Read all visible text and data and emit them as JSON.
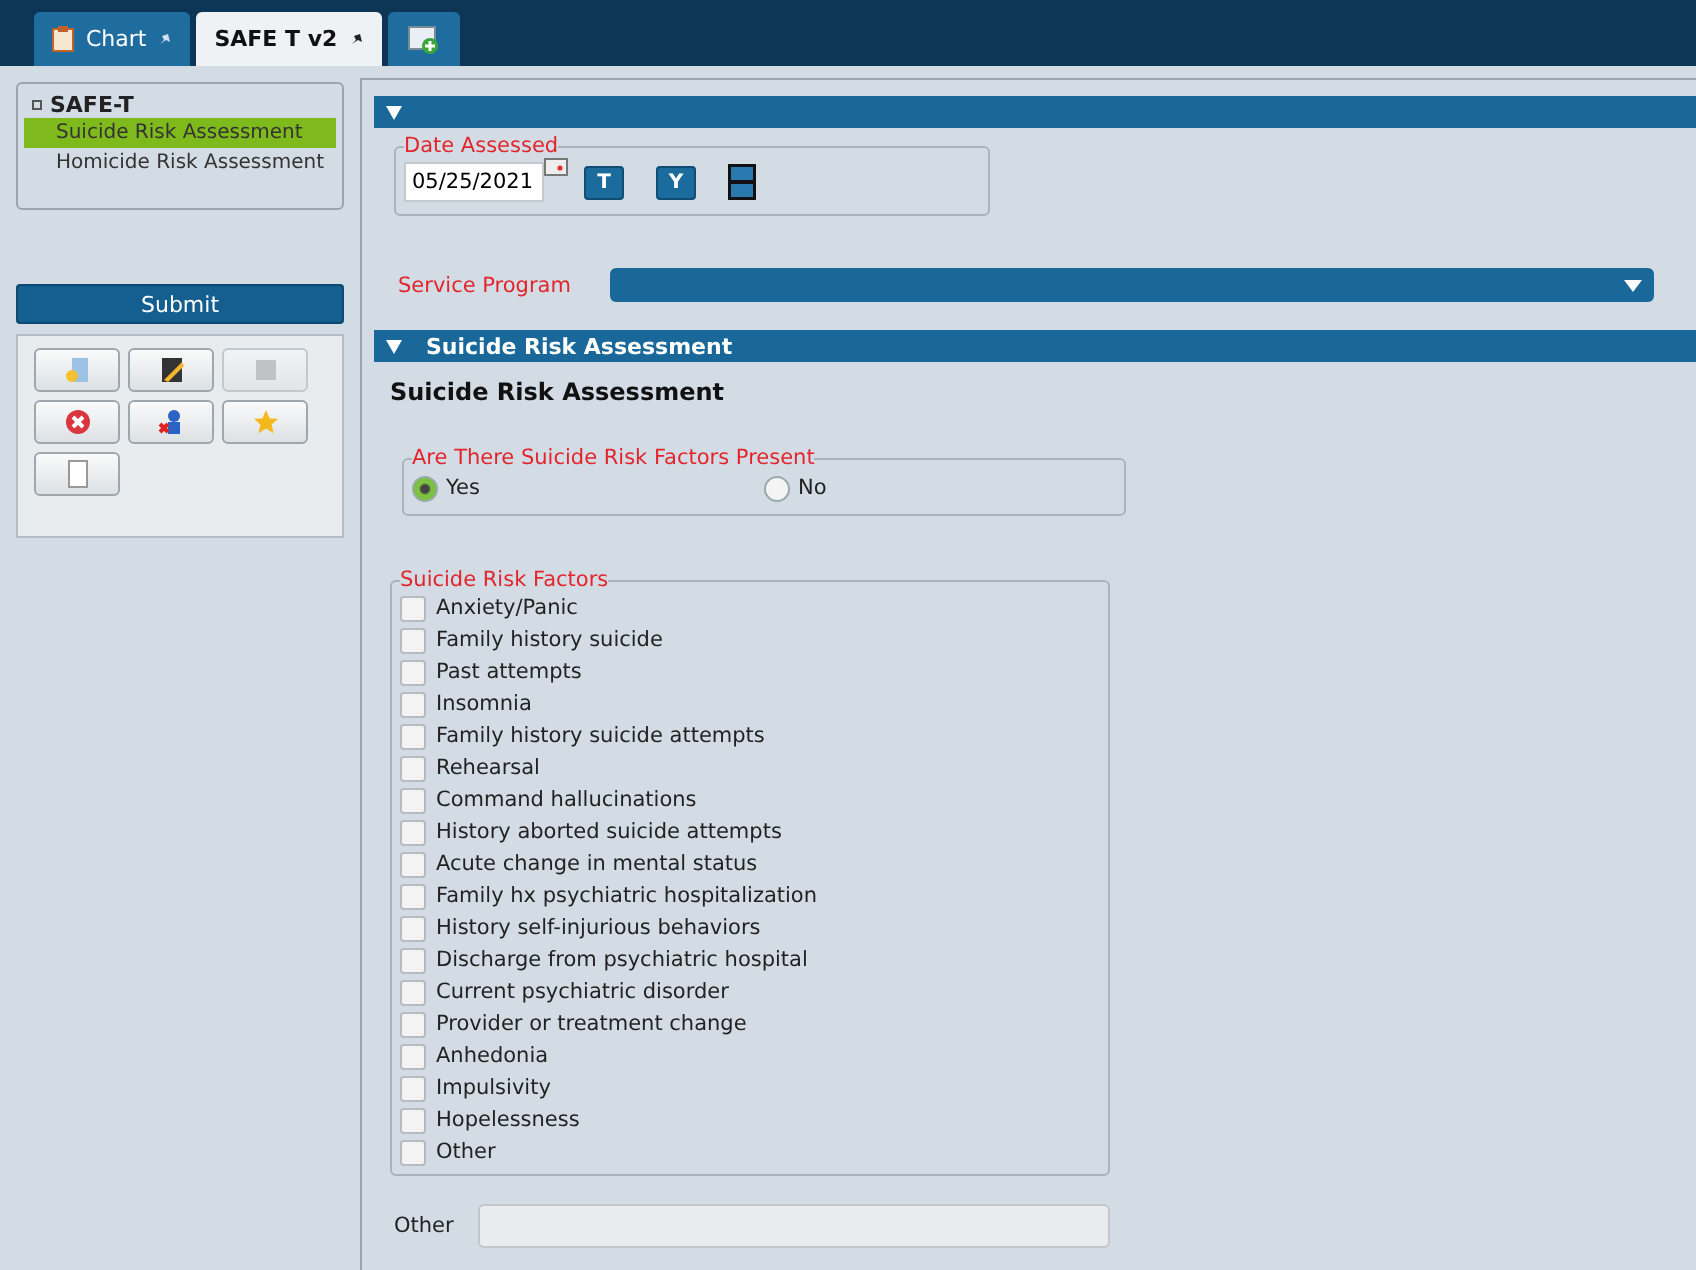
{
  "tabs": [
    {
      "label": "Chart",
      "selected": false
    },
    {
      "label": "SAFE T v2",
      "selected": true
    }
  ],
  "sidebar": {
    "group": "SAFE-T",
    "items": [
      {
        "label": "Suicide Risk Assessment",
        "selected": true
      },
      {
        "label": "Homicide Risk Assessment",
        "selected": false
      }
    ],
    "submit": "Submit",
    "toolbar": [
      {
        "disabled": false
      },
      {
        "disabled": false
      },
      {
        "disabled": true
      },
      {
        "disabled": false
      },
      {
        "disabled": false
      },
      {
        "disabled": false
      },
      {
        "disabled": false
      }
    ]
  },
  "form": {
    "date_assessed": {
      "label": "Date Assessed",
      "value": "05/25/2021",
      "today": "T",
      "yesterday": "Y"
    },
    "service_program": {
      "label": "Service Program"
    },
    "section": {
      "title": "Suicide Risk Assessment",
      "heading": "Suicide Risk Assessment"
    },
    "risk_present": {
      "label": "Are There Suicide Risk Factors Present",
      "options": [
        {
          "label": "Yes",
          "selected": true
        },
        {
          "label": "No",
          "selected": false
        }
      ]
    },
    "risk_factors": {
      "label": "Suicide Risk Factors",
      "items": [
        {
          "label": "Anxiety/Panic",
          "checked": false
        },
        {
          "label": "Family history suicide",
          "checked": false
        },
        {
          "label": "Past attempts",
          "checked": false
        },
        {
          "label": "Insomnia",
          "checked": false
        },
        {
          "label": "Family history suicide attempts",
          "checked": false
        },
        {
          "label": "Rehearsal",
          "checked": false
        },
        {
          "label": "Command hallucinations",
          "checked": false
        },
        {
          "label": "History aborted suicide attempts",
          "checked": false
        },
        {
          "label": "Acute change in mental status",
          "checked": false
        },
        {
          "label": "Family hx psychiatric hospitalization",
          "checked": false
        },
        {
          "label": "History self-injurious behaviors",
          "checked": false
        },
        {
          "label": "Discharge from psychiatric hospital",
          "checked": false
        },
        {
          "label": "Current psychiatric disorder",
          "checked": false
        },
        {
          "label": "Provider or treatment change",
          "checked": false
        },
        {
          "label": "Anhedonia",
          "checked": false
        },
        {
          "label": "Impulsivity",
          "checked": false
        },
        {
          "label": "Hopelessness",
          "checked": false
        },
        {
          "label": "Other",
          "checked": false
        }
      ]
    },
    "other": {
      "label": "Other"
    }
  }
}
